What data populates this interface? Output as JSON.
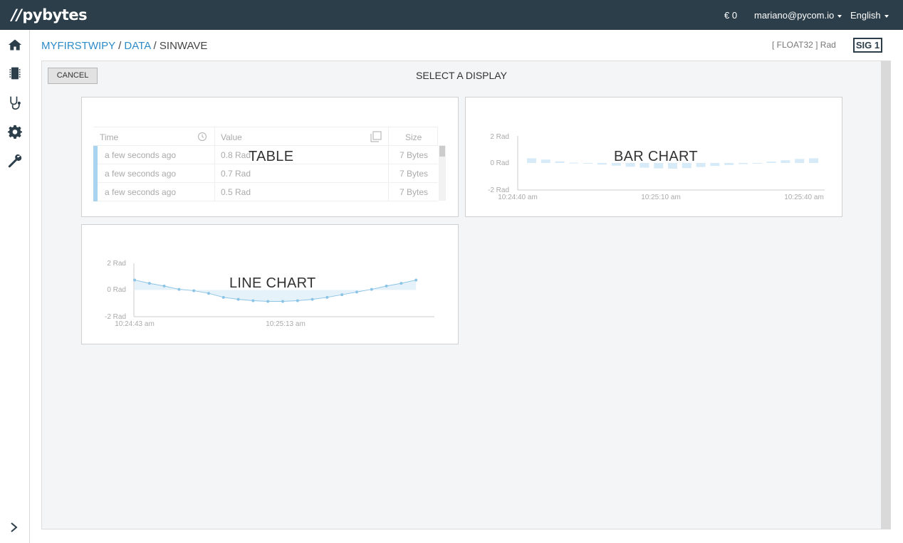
{
  "topbar": {
    "logo": "pybytes",
    "balance": "€ 0",
    "user": "mariano@pycom.io",
    "language": "English"
  },
  "sidebar": {
    "items": [
      {
        "icon": "home-icon"
      },
      {
        "icon": "device-icon"
      },
      {
        "icon": "stethoscope-icon"
      },
      {
        "icon": "gear-icon"
      },
      {
        "icon": "wrench-icon"
      }
    ],
    "expand_icon": "chevron-right-icon"
  },
  "breadcrumb": {
    "device": "MYFIRSTWIPY",
    "sep1": " / ",
    "section": "DATA",
    "sep2": " / ",
    "signal": "SINWAVE"
  },
  "signal_info": {
    "type": "[ FLOAT32 ] Rad",
    "badge": "SIG 1"
  },
  "panel": {
    "cancel_label": "CANCEL",
    "title": "SELECT A DISPLAY"
  },
  "table_card": {
    "label": "TABLE",
    "columns": [
      "Time",
      "Value",
      "Size"
    ],
    "rows": [
      {
        "time": "a few seconds ago",
        "value": "0.8 Rad",
        "size": "7 Bytes"
      },
      {
        "time": "a few seconds ago",
        "value": "0.7 Rad",
        "size": "7 Bytes"
      },
      {
        "time": "a few seconds ago",
        "value": "0.5 Rad",
        "size": "7 Bytes"
      }
    ],
    "history_icon": "history-icon",
    "copy_icon": "copy-icon"
  },
  "bar_card": {
    "label": "BAR CHART",
    "chart_data": {
      "type": "bar",
      "y_ticks": [
        "2 Rad",
        "0 Rad",
        "-2 Rad"
      ],
      "ylim": [
        -2,
        2
      ],
      "x_ticks": [
        "10:24:40 am",
        "10:25:10 am",
        "10:25:40 am"
      ],
      "values": [
        0.35,
        0.25,
        0.12,
        0.02,
        -0.03,
        -0.12,
        -0.2,
        -0.28,
        -0.35,
        -0.4,
        -0.42,
        -0.38,
        -0.3,
        -0.22,
        -0.15,
        -0.08,
        0.0,
        0.1,
        0.2,
        0.3,
        0.35
      ],
      "color": "#d6ebf7"
    }
  },
  "line_card": {
    "label": "LINE CHART",
    "chart_data": {
      "type": "line",
      "y_ticks": [
        "2 Rad",
        "0 Rad",
        "-2 Rad"
      ],
      "ylim": [
        -2,
        2
      ],
      "x_ticks": [
        "10:24:43 am",
        "10:25:13 am"
      ],
      "values": [
        0.75,
        0.5,
        0.3,
        0.05,
        -0.05,
        -0.25,
        -0.55,
        -0.7,
        -0.8,
        -0.85,
        -0.85,
        -0.8,
        -0.7,
        -0.55,
        -0.35,
        -0.15,
        0.05,
        0.3,
        0.5,
        0.75
      ],
      "color": "#8cc4e6"
    }
  }
}
